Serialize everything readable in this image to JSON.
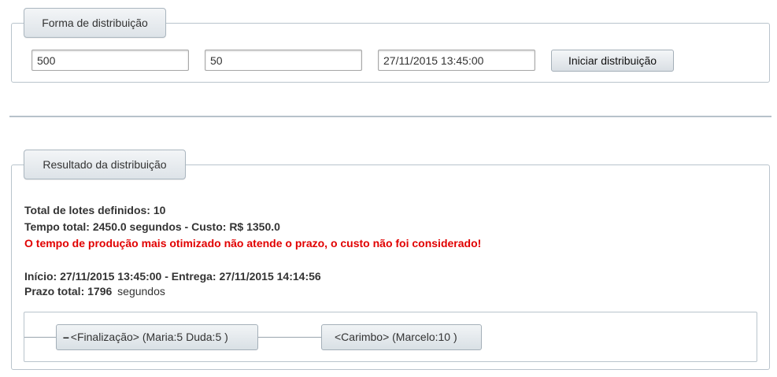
{
  "form": {
    "legend": "Forma de distribuição",
    "field1_value": "500",
    "field2_value": "50",
    "datetime_value": "27/11/2015 13:45:00",
    "start_button": "Iniciar distribuição"
  },
  "result": {
    "legend": "Resultado da distribuição",
    "total_lotes": "Total de lotes definidos: 10",
    "tempo_custo": "Tempo total: 2450.0 segundos - Custo: R$ 1350.0",
    "alert": "O tempo de produção mais otimizado não atende o prazo, o custo não foi considerado!",
    "inicio_entrega": "Início: 27/11/2015 13:45:00 - Entrega: 27/11/2015 14:14:56",
    "prazo_label": "Prazo total: 1796",
    "prazo_unit": "segundos",
    "tree": {
      "node1_toggle": "–",
      "node1_label": "<Finalização> (Maria:5 Duda:5 )",
      "node2_label": "<Carimbo> (Marcelo:10 )"
    }
  },
  "colors": {
    "alert": "#e10000",
    "border": "#b9c4cc"
  }
}
